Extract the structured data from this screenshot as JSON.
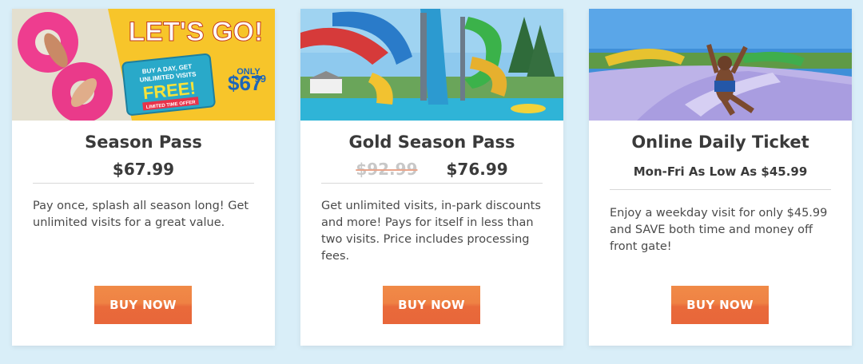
{
  "cards": [
    {
      "title": "Season Pass",
      "price": "$67.99",
      "description": "Pay once, splash all season long! Get unlimited visits for a great value.",
      "button": "BUY NOW",
      "banner": {
        "headline": "LET'S GO!",
        "offer_line1": "BUY A DAY, GET",
        "offer_line2": "UNLIMITED VISITS",
        "offer_free": "FREE!",
        "offer_tag": "LIMITED TIME OFFER",
        "only": "ONLY",
        "banner_price_main": "$67",
        "banner_price_cents": "99"
      }
    },
    {
      "title": "Gold Season Pass",
      "old_price": "$92.99",
      "price": "$76.99",
      "description": "Get unlimited visits, in-park discounts and more! Pays for itself in less than two visits. Price includes processing fees.",
      "button": "BUY NOW"
    },
    {
      "title": "Online Daily Ticket",
      "subtitle": "Mon-Fri As Low As $45.99",
      "description": "Enjoy a weekday visit for only $45.99 and SAVE both time and money off front gate!",
      "button": "BUY NOW"
    }
  ],
  "colors": {
    "page_bg": "#d9eef8",
    "button": "#ec7440",
    "banner_yellow": "#f7c52a"
  }
}
